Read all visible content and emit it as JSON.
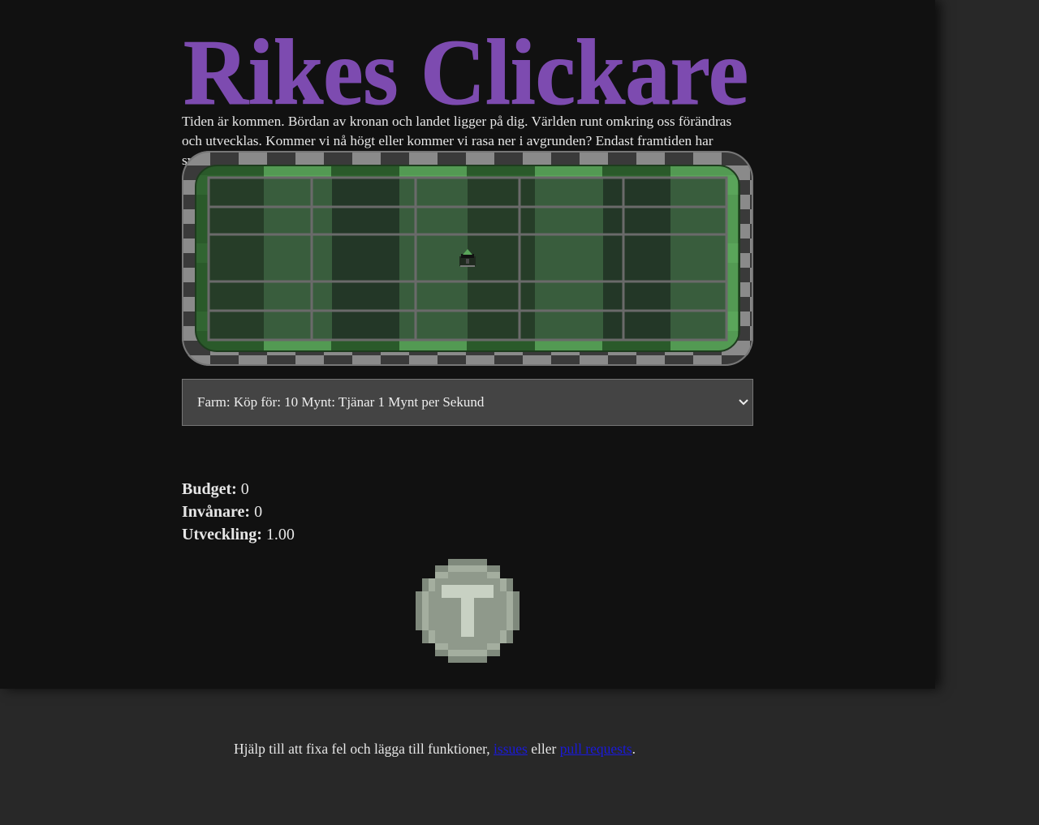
{
  "header": {
    "title": "Rikes Clickare",
    "title_color": "#7d4cb0"
  },
  "intro": {
    "text": "Tiden är kommen. Bördan av kronan och landet ligger på dig. Världen runt omkring oss förändras och utvecklas. Kommer vi nå högt eller kommer vi rasa ner i avgrunden? Endast framtiden har svaren."
  },
  "map": {
    "icon": "castle-icon"
  },
  "shop": {
    "selected_option": "Farm: Köp för: 10 Mynt: Tjänar 1 Mynt per Sekund"
  },
  "stats": {
    "budget_label": "Budget:",
    "budget_value": "0",
    "population_label": "Invånare:",
    "population_value": "0",
    "development_label": "Utveckling:",
    "development_value": "1.00"
  },
  "coin": {
    "icon": "coin-icon"
  },
  "footer": {
    "text_before": "Hjälp till att fixa fel och lägga till funktioner, ",
    "issues_link": "issues",
    "middle_text": " eller ",
    "pr_link": "pull requests",
    "end_text": "."
  },
  "colors": {
    "background": "#111111",
    "footer_background": "#282828",
    "grass_dark": "#2a5a2a",
    "grass_light": "#5aa55a",
    "link": "#1a1adb"
  }
}
